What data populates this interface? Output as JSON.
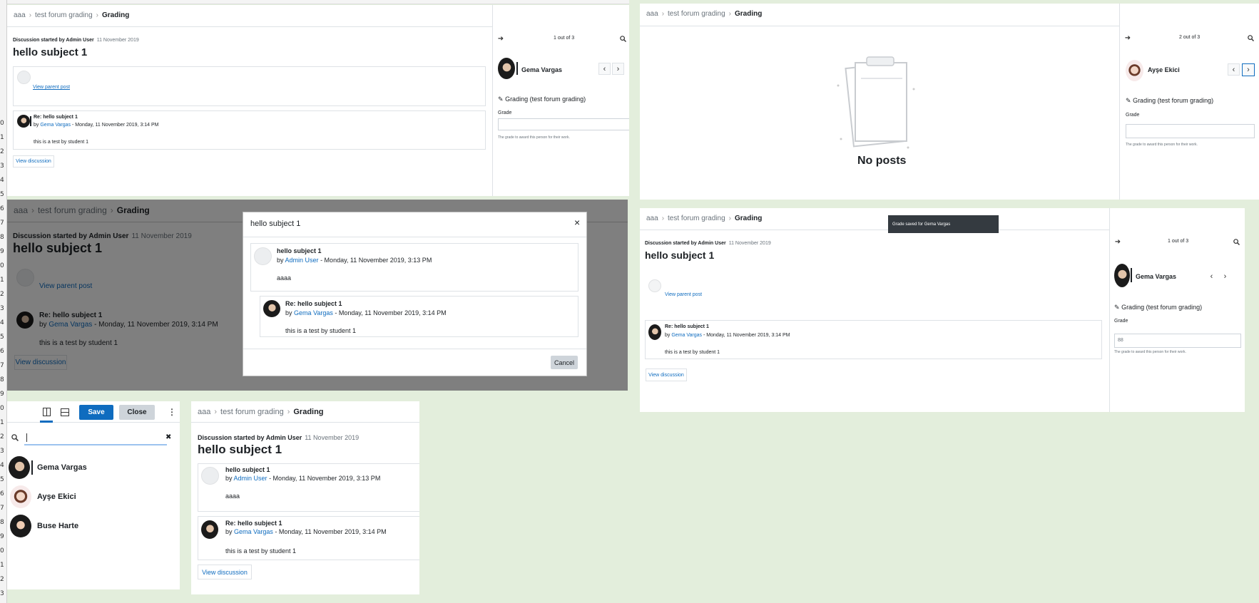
{
  "rows": {
    "numbers": [
      "0",
      "1",
      "2",
      "3",
      "4",
      "5",
      "6",
      "7",
      "8",
      "9",
      "0",
      "1",
      "2",
      "3",
      "4",
      "5",
      "6",
      "7",
      "8",
      "9",
      "0",
      "1",
      "2",
      "3",
      "4",
      "5",
      "6",
      "7",
      "8",
      "9",
      "0",
      "1",
      "2",
      "3"
    ]
  },
  "common": {
    "crumb1": "aaa",
    "crumb2": "test forum grading",
    "crumb3": "Grading",
    "save": "Save",
    "close": "Close",
    "kebab": "⋮",
    "started_by": "Discussion started by Admin User",
    "started_date": "11 November 2019",
    "subject": "hello subject 1",
    "view_parent": "View parent post",
    "reply_title": "Re: hello subject 1",
    "by": "by",
    "gema": "Gema Vargas",
    "aysee": "Ayşe Ekici",
    "buse": "Buse Harte",
    "admin": "Admin User",
    "reply_date": "- Monday, 11 November 2019, 3:14 PM",
    "orig_date": "- Monday, 11 November 2019, 3:13 PM",
    "reply_body": "this is a test by student 1",
    "orig_body": "aaaa",
    "view_discussion": "View discussion",
    "grading_title": "Grading (test forum grading)",
    "grade_label": "Grade",
    "grade_help": "The grade to award this person for their work."
  },
  "panel1": {
    "counter": "1 out of 3"
  },
  "panel2": {
    "counter": "2 out of 3",
    "no_posts": "No posts"
  },
  "panel4": {
    "counter": "1 out of 3",
    "toast": "Grade saved for Gema Vargas",
    "grade_value": "88"
  },
  "modal": {
    "title": "hello subject 1",
    "close_x": "×",
    "cancel": "Cancel"
  },
  "panel5": {
    "clear": "✖"
  }
}
